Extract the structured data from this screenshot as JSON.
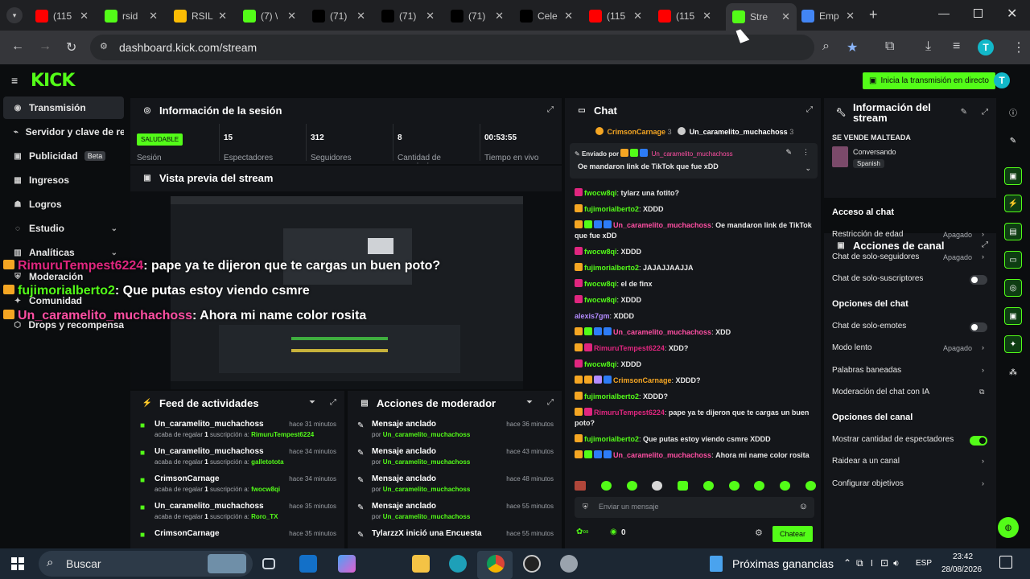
{
  "browser": {
    "tabs": [
      {
        "label": "(115",
        "color": "#ff0000"
      },
      {
        "label": "rsid",
        "color": "#53fc18"
      },
      {
        "label": "RSIL",
        "color": "#fbbc04"
      },
      {
        "label": "(7) \\",
        "color": "#53fc18"
      },
      {
        "label": "(71)",
        "color": "#000000"
      },
      {
        "label": "(71)",
        "color": "#000000"
      },
      {
        "label": "(71)",
        "color": "#000000"
      },
      {
        "label": "Cele",
        "color": "#000000"
      },
      {
        "label": "(115",
        "color": "#ff0000"
      },
      {
        "label": "(115",
        "color": "#ff0000"
      },
      {
        "label": "Stre",
        "color": "#53fc18"
      },
      {
        "label": "Emp",
        "color": "#4285f4"
      }
    ],
    "url": "dashboard.kick.com/stream",
    "profile_initial": "T"
  },
  "topnav": {
    "logo": "KICK",
    "live_button": "Inicia la transmisión en directo",
    "avatar_initial": "T"
  },
  "sidebar": {
    "items": [
      {
        "label": "Transmisión",
        "icon": "broadcast-icon"
      },
      {
        "label": "Servidor y clave de retransmisión",
        "icon": "link-icon"
      },
      {
        "label": "Publicidad",
        "badge": "Beta",
        "icon": "megaphone-icon"
      },
      {
        "label": "Ingresos",
        "icon": "money-icon"
      },
      {
        "label": "Logros",
        "icon": "trophy-icon"
      },
      {
        "label": "Estudio",
        "icon": "studio-icon"
      },
      {
        "label": "Analíticas",
        "icon": "chart-icon"
      },
      {
        "label": "Moderación",
        "icon": "shield-icon"
      },
      {
        "label": "Comunidad",
        "icon": "people-icon"
      },
      {
        "label": "Drops y recompensas",
        "icon": "gift-icon"
      }
    ]
  },
  "session": {
    "title": "Información de la sesión",
    "status": "SALUDABLE",
    "status_label": "Sesión",
    "stats": [
      {
        "value": "15",
        "label": "Espectadores"
      },
      {
        "value": "312",
        "label": "Seguidores"
      },
      {
        "value": "8",
        "label": "Cantidad de suscripciones"
      },
      {
        "value": "00:53:55",
        "label": "Tiempo en vivo"
      }
    ]
  },
  "preview": {
    "title": "Vista previa del stream"
  },
  "overlay_chat": [
    {
      "user": "RimuruTempest6224",
      "text": ": pape ya te dijeron que te cargas un buen poto?",
      "color": "#e0267f"
    },
    {
      "user": "fujimorialberto2",
      "text": ": Que putas estoy viendo csmre",
      "color": "#53fc18"
    },
    {
      "user": "Un_caramelito_muchachoss",
      "text": ": Ahora mi name color rosita",
      "color": "#ff4fa3"
    }
  ],
  "feed": {
    "title": "Feed de actividades",
    "items": [
      {
        "user": "Un_caramelito_muchachoss",
        "time": "hace 31 minutos",
        "action": "acaba de regalar",
        "count": "1",
        "suffix": "suscripción a:",
        "target": "RimuruTempest6224"
      },
      {
        "user": "Un_caramelito_muchachoss",
        "time": "hace 34 minutos",
        "action": "acaba de regalar",
        "count": "1",
        "suffix": "suscripción a:",
        "target": "galletotota"
      },
      {
        "user": "CrimsonCarnage",
        "time": "hace 34 minutos",
        "action": "acaba de regalar",
        "count": "1",
        "suffix": "suscripción a:",
        "target": "fwocw8qi"
      },
      {
        "user": "Un_caramelito_muchachoss",
        "time": "hace 35 minutos",
        "action": "acaba de regalar",
        "count": "1",
        "suffix": "suscripción a:",
        "target": "Roro_TX"
      },
      {
        "user": "CrimsonCarnage",
        "time": "hace 35 minutos",
        "action": "",
        "count": "",
        "suffix": "",
        "target": ""
      }
    ]
  },
  "modactions": {
    "title": "Acciones de moderador",
    "items": [
      {
        "title": "Mensaje anclado",
        "by": "por",
        "user": "Un_caramelito_muchachoss",
        "time": "hace 36 minutos"
      },
      {
        "title": "Mensaje anclado",
        "by": "por",
        "user": "Un_caramelito_muchachoss",
        "time": "hace 43 minutos"
      },
      {
        "title": "Mensaje anclado",
        "by": "por",
        "user": "Un_caramelito_muchachoss",
        "time": "hace 48 minutos"
      },
      {
        "title": "Mensaje anclado",
        "by": "por",
        "user": "Un_caramelito_muchachoss",
        "time": "hace 55 minutos"
      },
      {
        "title": "TylarzzX inició una Encuesta",
        "by": "",
        "user": "",
        "time": "hace 55 minutos"
      }
    ]
  },
  "chat": {
    "title": "Chat",
    "top_users": [
      {
        "user": "CrimsonCarnage",
        "count": "3"
      },
      {
        "user": "Un_caramelito_muchachoss",
        "count": "3"
      }
    ],
    "pinned_by_label": "Enviado por",
    "pinned_user": "Un_caramelito_muchachoss",
    "pinned_text": "Oe mandaron link de TikTok que fue xDD",
    "messages": [
      {
        "user": "fwocw8qi",
        "text": "tylarz una fotito?",
        "color": "#53fc18",
        "icons": [
          "#e0267f"
        ]
      },
      {
        "user": "fujimorialberto2",
        "text": "XDDD",
        "color": "#53fc18",
        "icons": [
          "#f5a623"
        ]
      },
      {
        "user": "Un_caramelito_muchachoss",
        "text": "Oe mandaron link de TikTok que fue xDD",
        "color": "#ff4fa3",
        "icons": [
          "#f5a623",
          "#53fc18",
          "#2d7cf6",
          "#2d7cf6"
        ]
      },
      {
        "user": "fwocw8qi",
        "text": "XDDD",
        "color": "#53fc18",
        "icons": [
          "#e0267f"
        ]
      },
      {
        "user": "fujimorialberto2",
        "text": "JAJAJJAAJJA",
        "color": "#53fc18",
        "icons": [
          "#f5a623"
        ]
      },
      {
        "user": "fwocw8qi",
        "text": "el de finx",
        "color": "#53fc18",
        "icons": [
          "#e0267f"
        ]
      },
      {
        "user": "fwocw8qi",
        "text": "XDDD",
        "color": "#53fc18",
        "icons": [
          "#e0267f"
        ]
      },
      {
        "user": "alexis7gm",
        "text": "XDDD",
        "color": "#b48cff",
        "icons": []
      },
      {
        "user": "Un_caramelito_muchachoss",
        "text": "XDD",
        "color": "#ff4fa3",
        "icons": [
          "#f5a623",
          "#53fc18",
          "#2d7cf6",
          "#2d7cf6"
        ]
      },
      {
        "user": "RimuruTempest6224",
        "text": "XDD?",
        "color": "#e0267f",
        "icons": [
          "#f5a623",
          "#e0267f"
        ]
      },
      {
        "user": "fwocw8qi",
        "text": "XDDD",
        "color": "#53fc18",
        "icons": [
          "#e0267f"
        ]
      },
      {
        "user": "CrimsonCarnage",
        "text": "XDDD?",
        "color": "#f5a623",
        "icons": [
          "#f5a623",
          "#f5a623",
          "#b48cff",
          "#2d7cf6"
        ]
      },
      {
        "user": "fujimorialberto2",
        "text": "XDDD?",
        "color": "#53fc18",
        "icons": [
          "#f5a623"
        ]
      },
      {
        "user": "RimuruTempest6224",
        "text": "pape ya te dijeron que te cargas un buen poto?",
        "color": "#e0267f",
        "icons": [
          "#f5a623",
          "#e0267f"
        ]
      },
      {
        "user": "fujimorialberto2",
        "text": "Que putas estoy viendo csmre XDDD",
        "color": "#53fc18",
        "icons": [
          "#f5a623"
        ]
      },
      {
        "user": "Un_caramelito_muchachoss",
        "text": "Ahora mi name color rosita",
        "color": "#ff4fa3",
        "icons": [
          "#f5a623",
          "#53fc18",
          "#2d7cf6",
          "#2d7cf6"
        ]
      }
    ],
    "input_placeholder": "Enviar un mensaje",
    "points": "0",
    "send_label": "Chatear"
  },
  "stream_info": {
    "title": "Información del stream",
    "stream_title": "SE VENDE MALTEADA",
    "category": "Conversando",
    "language": "Spanish"
  },
  "channel_actions": {
    "title": "Acciones de canal",
    "sections": [
      {
        "heading": "Acceso al chat",
        "rows": [
          {
            "label": "Restricción de edad",
            "value": "Apagado",
            "type": "select"
          },
          {
            "label": "Chat de solo-seguidores",
            "value": "Apagado",
            "type": "select"
          },
          {
            "label": "Chat de solo-suscriptores",
            "value": "",
            "type": "toggle",
            "on": false
          }
        ]
      },
      {
        "heading": "Opciones del chat",
        "rows": [
          {
            "label": "Chat de solo-emotes",
            "value": "",
            "type": "toggle",
            "on": false
          },
          {
            "label": "Modo lento",
            "value": "Apagado",
            "type": "select"
          },
          {
            "label": "Palabras baneadas",
            "value": "",
            "type": "link"
          },
          {
            "label": "Moderación del chat con IA",
            "value": "",
            "type": "external"
          }
        ]
      },
      {
        "heading": "Opciones del canal",
        "rows": [
          {
            "label": "Mostrar cantidad de espectadores",
            "value": "",
            "type": "toggle",
            "on": true
          },
          {
            "label": "Raidear a un canal",
            "value": "",
            "type": "link"
          },
          {
            "label": "Configurar objetivos",
            "value": "",
            "type": "link"
          }
        ]
      }
    ]
  },
  "taskbar": {
    "search_placeholder": "Buscar",
    "widget_text": "Próximas ganancias",
    "language": "ESP",
    "time": "23:42",
    "date": "28/08/2026"
  }
}
